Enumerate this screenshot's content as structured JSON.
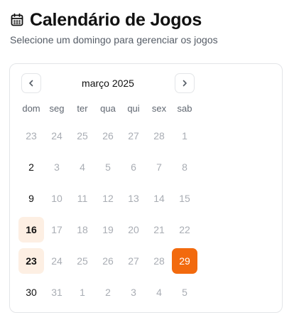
{
  "header": {
    "title": "Calendário de Jogos",
    "subtitle": "Selecione um domingo para gerenciar os jogos",
    "icon": "calendar-icon"
  },
  "calendar": {
    "month_label": "março 2025",
    "prev_icon": "chevron-left-icon",
    "next_icon": "chevron-right-icon",
    "weekdays": [
      "dom",
      "seg",
      "ter",
      "qua",
      "qui",
      "sex",
      "sab"
    ],
    "accent_color": "#f26a0e",
    "highlight_color": "#fdefe3",
    "weeks": [
      [
        {
          "d": "23",
          "s": "muted"
        },
        {
          "d": "24",
          "s": "muted"
        },
        {
          "d": "25",
          "s": "muted"
        },
        {
          "d": "26",
          "s": "muted"
        },
        {
          "d": "27",
          "s": "muted"
        },
        {
          "d": "28",
          "s": "muted"
        },
        {
          "d": "1",
          "s": "muted"
        }
      ],
      [
        {
          "d": "2",
          "s": "normal"
        },
        {
          "d": "3",
          "s": "muted"
        },
        {
          "d": "4",
          "s": "muted"
        },
        {
          "d": "5",
          "s": "muted"
        },
        {
          "d": "6",
          "s": "muted"
        },
        {
          "d": "7",
          "s": "muted"
        },
        {
          "d": "8",
          "s": "muted"
        }
      ],
      [
        {
          "d": "9",
          "s": "normal"
        },
        {
          "d": "10",
          "s": "muted"
        },
        {
          "d": "11",
          "s": "muted"
        },
        {
          "d": "12",
          "s": "muted"
        },
        {
          "d": "13",
          "s": "muted"
        },
        {
          "d": "14",
          "s": "muted"
        },
        {
          "d": "15",
          "s": "muted"
        }
      ],
      [
        {
          "d": "16",
          "s": "highlight"
        },
        {
          "d": "17",
          "s": "muted"
        },
        {
          "d": "18",
          "s": "muted"
        },
        {
          "d": "19",
          "s": "muted"
        },
        {
          "d": "20",
          "s": "muted"
        },
        {
          "d": "21",
          "s": "muted"
        },
        {
          "d": "22",
          "s": "muted"
        }
      ],
      [
        {
          "d": "23",
          "s": "highlight"
        },
        {
          "d": "24",
          "s": "muted"
        },
        {
          "d": "25",
          "s": "muted"
        },
        {
          "d": "26",
          "s": "muted"
        },
        {
          "d": "27",
          "s": "muted"
        },
        {
          "d": "28",
          "s": "muted"
        },
        {
          "d": "29",
          "s": "selected"
        }
      ],
      [
        {
          "d": "30",
          "s": "normal"
        },
        {
          "d": "31",
          "s": "muted"
        },
        {
          "d": "1",
          "s": "muted"
        },
        {
          "d": "2",
          "s": "muted"
        },
        {
          "d": "3",
          "s": "muted"
        },
        {
          "d": "4",
          "s": "muted"
        },
        {
          "d": "5",
          "s": "muted"
        }
      ]
    ]
  }
}
